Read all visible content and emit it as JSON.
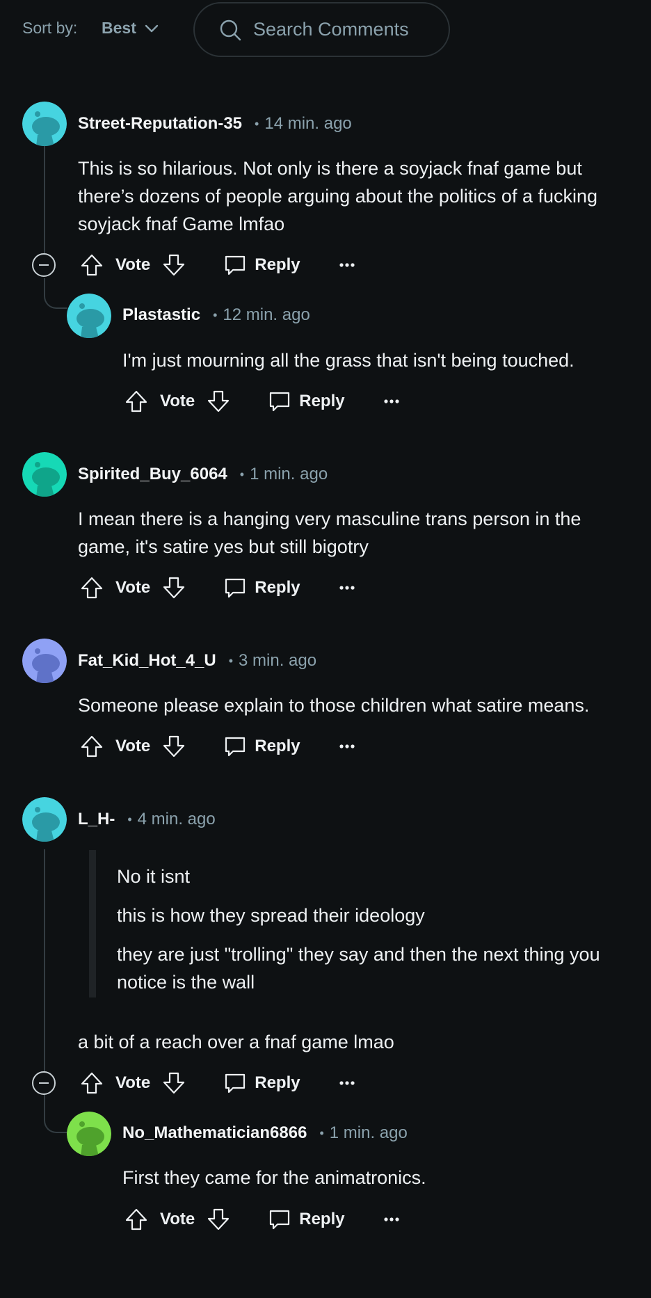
{
  "sort": {
    "label": "Sort by:",
    "value": "Best"
  },
  "search": {
    "placeholder": "Search Comments"
  },
  "actions": {
    "vote": "Vote",
    "reply": "Reply"
  },
  "comments": [
    {
      "author": "Street-Reputation-35",
      "time": "14 min. ago",
      "avatar_color": "#46d4e0",
      "body": "This is so hilarious. Not only is there a soyjack fnaf game but there’s dozens of people arguing about the politics of a fucking soyjack fnaf Game lmfao",
      "replies": [
        {
          "author": "Plastastic",
          "time": "12 min. ago",
          "avatar_color": "#46d4e0",
          "body": "I'm just mourning all the grass that isn't being touched."
        }
      ]
    },
    {
      "author": "Spirited_Buy_6064",
      "time": "1 min. ago",
      "avatar_color": "#16d9b6",
      "body": "I mean there is a hanging very masculine trans person in the game, it's satire yes but still bigotry"
    },
    {
      "author": "Fat_Kid_Hot_4_U",
      "time": "3 min. ago",
      "avatar_color": "#8fa1f5",
      "body": "Someone please explain to those children what satire means."
    },
    {
      "author": "L_H-",
      "time": "4 min. ago",
      "avatar_color": "#46d4e0",
      "quote": [
        "No it isnt",
        "this is how they spread their ideology",
        "they are just \"trolling\" they say and then the next thing you notice is the wall"
      ],
      "body": "a bit of a reach over a fnaf game lmao",
      "replies": [
        {
          "author": "No_Mathematician6866",
          "time": "1 min. ago",
          "avatar_color": "#7ee04b",
          "body": "First they came for the animatronics."
        }
      ]
    }
  ]
}
